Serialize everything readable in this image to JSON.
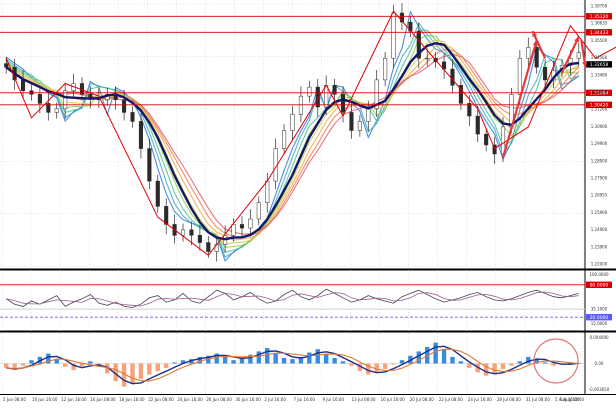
{
  "theme": {
    "background": "#ffffff",
    "grid": "#c8c8c8",
    "separator": "#000000",
    "level_line": "#d40000",
    "level_label_bg": "#d40000",
    "mean_line": "#5a5aff",
    "bull_candle": "#2a2a2a",
    "bear_candle": "#2a2a2a",
    "ma_thick": "#15156b",
    "zigzag": "#e00000",
    "osc_main": "#444444",
    "osc_signal": "#9a5a9a",
    "hist_up": "#3a8be0",
    "hist_down": "#f5a37a",
    "macd_line": "#1f2f8a",
    "macd_signal": "#e07a2f",
    "circle": "#e57a7a",
    "cur_price_bg": "#000000",
    "ribbon_colors": [
      "#2e7bd1",
      "#3fa7c9",
      "#4cbf8f",
      "#8fcf4a",
      "#d5d04a",
      "#f0a845",
      "#ee7a4f",
      "#e65a6a"
    ]
  },
  "chart_data": [
    {
      "type": "candlestick",
      "title": "",
      "x_labels": [
        "5 Jun 08:00",
        "10 Jun 16:00",
        "12 Jun 16:00",
        "16 Jun 08:00",
        "18 Jun 16:00",
        "22 Jun 08:00",
        "24 Jun 16:00",
        "26 Jun 08:00",
        "30 Jun 16:00",
        "2 Jul 16:00",
        "7 Jul 16:00",
        "9 Jul 16:00",
        "13 Jul 08:00",
        "16 Jul 16:00",
        "20 Jul 08:00",
        "22 Jul 08:00",
        "24 Jul 16:00",
        "28 Jul 08:00",
        "31 Jul 08:00",
        "5 Aug 16:00",
        "5 Aug 10:00"
      ],
      "y_tick_labels": [
        "1.39700",
        "1.36635",
        "1.35500",
        "1.34560",
        "1.33480",
        "1.32400",
        "1.31260",
        "1.30900",
        "1.29900",
        "1.28900",
        "1.27900",
        "1.26955",
        "1.25900",
        "1.24900",
        "1.23900",
        "1.22000"
      ],
      "levels": [
        {
          "label": "1.34433",
          "value": 1.34433
        },
        {
          "label": "1.35320",
          "value": 1.3532
        },
        {
          "label": "1.31084",
          "value": 1.31084
        },
        {
          "label": "1.30420",
          "value": 1.3042
        }
      ],
      "current_price_label": "1.32658",
      "current_price": 1.32658,
      "ylim": [
        1.215,
        1.36
      ],
      "close_path": [
        1.325,
        1.318,
        1.312,
        1.31,
        1.305,
        1.3,
        1.302,
        1.312,
        1.316,
        1.31,
        1.308,
        1.307,
        1.31,
        1.307,
        1.3,
        1.295,
        1.28,
        1.262,
        1.248,
        1.238,
        1.232,
        1.235,
        1.232,
        1.228,
        1.223,
        1.227,
        1.232,
        1.238,
        1.236,
        1.241,
        1.25,
        1.262,
        1.28,
        1.29,
        1.299,
        1.309,
        1.314,
        1.303,
        1.315,
        1.31,
        1.3,
        1.29,
        1.295,
        1.302,
        1.318,
        1.33,
        1.355,
        1.35,
        1.345,
        1.33,
        1.33,
        1.328,
        1.324,
        1.315,
        1.305,
        1.298,
        1.288,
        1.282,
        1.277,
        1.292,
        1.31,
        1.33,
        1.336,
        1.325,
        1.318,
        1.323,
        1.326,
        1.33,
        1.333
      ],
      "ribbon_offsets": [
        -0.0095,
        -0.0075,
        -0.0058,
        -0.0042,
        -0.0028,
        -0.0015,
        -0.0005,
        0.0005
      ],
      "ma_lag": 6,
      "zigzag": [
        [
          0,
          1.33
        ],
        [
          3,
          1.297
        ],
        [
          7,
          1.316
        ],
        [
          11,
          1.309
        ],
        [
          18,
          1.242
        ],
        [
          24,
          1.221
        ],
        [
          31,
          1.262
        ],
        [
          38,
          1.315
        ],
        [
          40,
          1.298
        ],
        [
          46,
          1.356
        ],
        [
          56,
          1.302
        ],
        [
          58,
          1.28
        ],
        [
          62,
          1.292
        ],
        [
          67,
          1.348
        ],
        [
          70,
          1.33
        ],
        [
          74,
          1.34
        ],
        [
          76,
          1.322
        ]
      ]
    },
    {
      "type": "line",
      "series": [
        {
          "values": [
            54,
            44,
            40,
            50,
            44,
            52,
            60,
            40,
            48,
            54,
            62,
            46,
            42,
            48,
            40,
            38,
            44,
            56,
            60,
            48,
            52,
            64,
            50,
            46,
            58,
            70,
            64,
            52,
            58,
            66,
            54,
            46,
            50,
            62,
            70,
            58,
            52,
            60,
            72,
            64,
            56,
            48,
            52,
            60,
            54,
            50,
            46,
            58,
            64,
            70,
            62,
            54,
            48,
            52,
            56,
            62,
            66,
            58,
            52,
            50,
            54,
            60,
            66,
            70,
            64,
            58,
            56,
            60,
            64
          ]
        }
      ],
      "ylim": [
        0,
        100
      ],
      "levels": [
        {
          "label": "80.0000",
          "value": 80
        },
        {
          "label": "35.1000",
          "value": 35.1
        },
        {
          "label": "20.0000",
          "value": 20
        }
      ],
      "extra_labels": [
        "100.0000",
        "15.0000"
      ]
    },
    {
      "type": "bar",
      "ylim": [
        -0.005,
        0.005
      ],
      "tick_labels": [
        "0.004090",
        "0.00",
        "-0.003650"
      ],
      "values": [
        -0.0008,
        -0.0012,
        -0.0004,
        0.0006,
        0.0012,
        0.0018,
        0.0008,
        -0.0006,
        -0.0012,
        -0.0005,
        0.0004,
        -0.0006,
        -0.0018,
        -0.0032,
        -0.0042,
        -0.0036,
        -0.0028,
        -0.002,
        -0.0014,
        -0.0008,
        0.0002,
        0.0006,
        0.0008,
        0.0012,
        0.0014,
        0.0018,
        0.0012,
        0.0006,
        0.001,
        0.0016,
        0.0022,
        0.0028,
        0.0018,
        0.001,
        0.0008,
        0.0012,
        0.002,
        0.0026,
        0.0018,
        0.001,
        0.0004,
        -0.0004,
        -0.0014,
        -0.002,
        -0.0016,
        -0.001,
        -0.0002,
        0.0006,
        0.0014,
        0.0022,
        0.003,
        0.0038,
        0.0026,
        0.0012,
        0.0004,
        -0.0008,
        -0.0016,
        -0.0022,
        -0.0018,
        -0.001,
        -0.0004,
        0.0004,
        0.0012,
        0.0008,
        0.0002,
        -0.0004,
        -0.0002,
        0.0002,
        0.0001
      ]
    }
  ]
}
